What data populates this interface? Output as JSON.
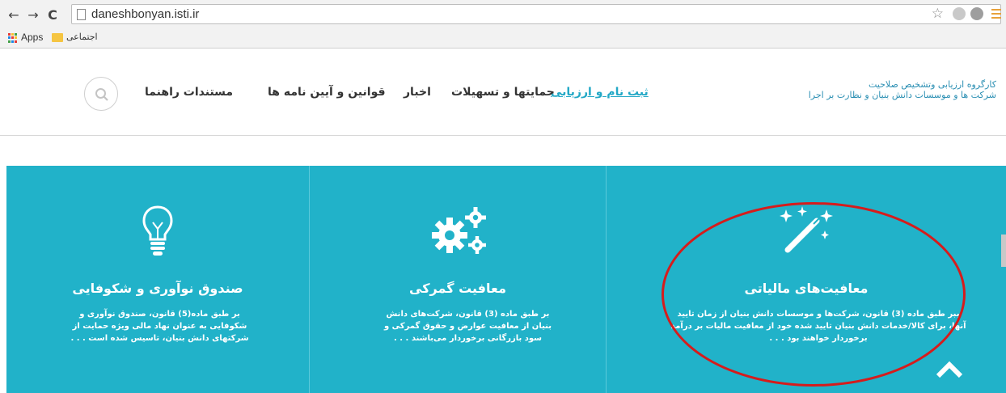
{
  "browser": {
    "url": "daneshbonyan.isti.ir",
    "bookmarks": [
      {
        "label": "Apps"
      },
      {
        "label": "اجتماعی"
      }
    ]
  },
  "site": {
    "brand_line1": "کارگروه ارزیابی وتشخیص صلاحیت",
    "brand_line2": "شرکت ها و موسسات دانش بنیان و نظارت بر اجرا",
    "nav": [
      {
        "label": "ثبت نام و ارزیابی",
        "active": true
      },
      {
        "label": "حمایتها و تسهیلات"
      },
      {
        "label": "اخبار"
      },
      {
        "label": "قوانین و آیین نامه ها"
      },
      {
        "label": "مستندات راهنما"
      }
    ]
  },
  "features": [
    {
      "icon": "lightbulb-icon",
      "title": "صندوق نوآوری و شکوفایی",
      "description": "بر طبق ماده(5) قانون، صندوق نوآوری و شکوفایی به عنوان نهاد مالی ویژه حمایت از شرکتهای دانش بنیان، تاسیس شده است . . ."
    },
    {
      "icon": "gears-icon",
      "title": "معافیت گمرکی",
      "description": "بر طبق ماده (3) قانون، شرکت‌های دانش بنیان از معافیت عوارض و حقوق گمرکی و سود بازرگانی برخوردار می‌باشند . . ."
    },
    {
      "icon": "magic-wand-icon",
      "title": "معافیت‌های مالیاتی",
      "description": "ببر طبق ماده (3) قانون، شرکت‌ها و موسسات دانش بنیان از زمان تایید آنها، برای کالا/خدمات دانش بنیان تایید شده خود از معافیت مالیات بر درآمد برخوردار خواهند بود . . ."
    }
  ],
  "colors": {
    "accent": "#21b2c9",
    "annotation": "#d61c1c"
  }
}
